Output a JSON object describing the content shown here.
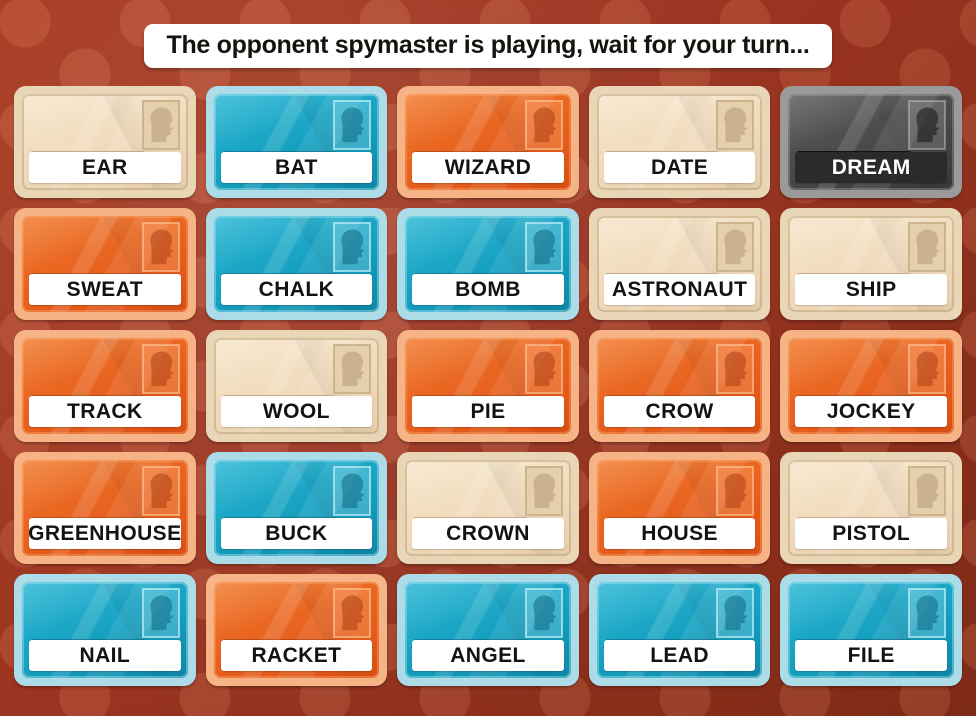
{
  "banner": {
    "status_text": "The opponent spymaster is playing, wait for your turn..."
  },
  "board": {
    "columns": 5,
    "rows": 5,
    "stamp_icon": "head-silhouette-icon",
    "legend": {
      "orange_label": "red-team",
      "teal_label": "blue-team",
      "neutral_label": "bystander",
      "assassin_label": "assassin"
    },
    "colors": {
      "background": "#9a3420",
      "orange_card": "#e8631f",
      "orange_frame": "#f6b486",
      "teal_card": "#17a2c2",
      "teal_frame": "#abdce8",
      "neutral_card": "#f0dabb",
      "neutral_frame": "#e8d6b6",
      "assassin_card": "#4a4a4a",
      "assassin_frame": "#9a9a9a",
      "plate": "#ffffff",
      "assassin_plate": "#2b2b2b",
      "word_text": "#151210",
      "assassin_word_text": "#ffffff"
    },
    "cards": [
      {
        "word": "EAR",
        "type": "neutral"
      },
      {
        "word": "BAT",
        "type": "teal"
      },
      {
        "word": "WIZARD",
        "type": "orange"
      },
      {
        "word": "DATE",
        "type": "neutral"
      },
      {
        "word": "DREAM",
        "type": "assassin"
      },
      {
        "word": "SWEAT",
        "type": "orange"
      },
      {
        "word": "CHALK",
        "type": "teal"
      },
      {
        "word": "BOMB",
        "type": "teal"
      },
      {
        "word": "ASTRONAUT",
        "type": "neutral"
      },
      {
        "word": "SHIP",
        "type": "neutral"
      },
      {
        "word": "TRACK",
        "type": "orange"
      },
      {
        "word": "WOOL",
        "type": "neutral"
      },
      {
        "word": "PIE",
        "type": "orange"
      },
      {
        "word": "CROW",
        "type": "orange"
      },
      {
        "word": "JOCKEY",
        "type": "orange"
      },
      {
        "word": "GREENHOUSE",
        "type": "orange"
      },
      {
        "word": "BUCK",
        "type": "teal"
      },
      {
        "word": "CROWN",
        "type": "neutral"
      },
      {
        "word": "HOUSE",
        "type": "orange"
      },
      {
        "word": "PISTOL",
        "type": "neutral"
      },
      {
        "word": "NAIL",
        "type": "teal"
      },
      {
        "word": "RACKET",
        "type": "orange"
      },
      {
        "word": "ANGEL",
        "type": "teal"
      },
      {
        "word": "LEAD",
        "type": "teal"
      },
      {
        "word": "FILE",
        "type": "teal"
      }
    ]
  }
}
